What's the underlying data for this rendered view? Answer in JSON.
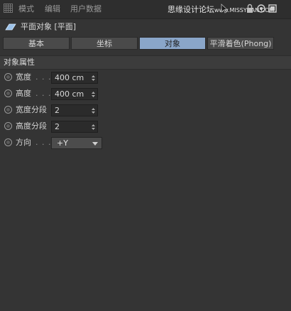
{
  "menu": {
    "items": [
      "模式",
      "编辑",
      "用户数据"
    ]
  },
  "watermark": {
    "text": "思缘设计论坛",
    "url": "www.MISSYUAN.COM"
  },
  "header": {
    "title": "平面对象 [平面]"
  },
  "tabs": [
    {
      "label": "基本",
      "active": false
    },
    {
      "label": "坐标",
      "active": false
    },
    {
      "label": "对象",
      "active": true
    },
    {
      "label": "平滑着色(Phong)",
      "active": false
    }
  ],
  "section": {
    "title": "对象属性"
  },
  "properties": [
    {
      "label": "宽度",
      "dots": ". . .",
      "value": "400 cm",
      "type": "number"
    },
    {
      "label": "高度",
      "dots": ". . .",
      "value": "400 cm",
      "type": "number"
    },
    {
      "label": "宽度分段",
      "dots": "",
      "value": "2",
      "type": "number"
    },
    {
      "label": "高度分段",
      "dots": "",
      "value": "2",
      "type": "number"
    },
    {
      "label": "方向",
      "dots": ". . .",
      "value": "+Y",
      "type": "select"
    }
  ],
  "colors": {
    "background": "#343434",
    "active_tab": "#8aa6c9",
    "field": "#2b2b2b"
  }
}
